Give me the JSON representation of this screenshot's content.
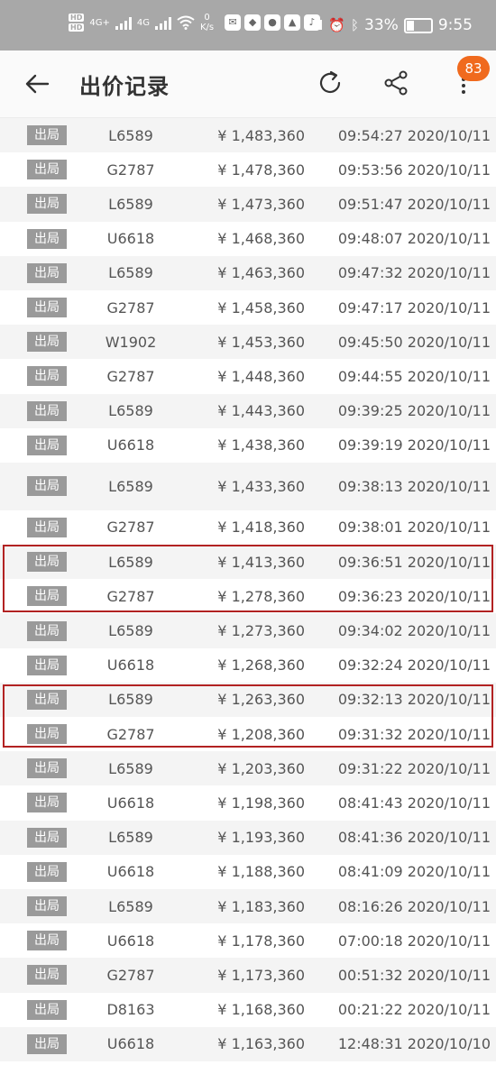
{
  "status_bar": {
    "hd1": "HD",
    "hd2": "HD",
    "net1": "4G+",
    "net2": "4G",
    "speed_value": "0",
    "speed_unit": "K/s",
    "battery": "33%",
    "time": "9:55",
    "battery_level": 0.33
  },
  "header": {
    "title": "出价记录",
    "badge": "83"
  },
  "tag_label": "出局",
  "bids": [
    {
      "tag": "出局",
      "bidder": "L6589",
      "price": "¥ 1,483,360",
      "time": "09:54:27 2020/10/11"
    },
    {
      "tag": "出局",
      "bidder": "G2787",
      "price": "¥ 1,478,360",
      "time": "09:53:56 2020/10/11"
    },
    {
      "tag": "出局",
      "bidder": "L6589",
      "price": "¥ 1,473,360",
      "time": "09:51:47 2020/10/11"
    },
    {
      "tag": "出局",
      "bidder": "U6618",
      "price": "¥ 1,468,360",
      "time": "09:48:07 2020/10/11"
    },
    {
      "tag": "出局",
      "bidder": "L6589",
      "price": "¥ 1,463,360",
      "time": "09:47:32 2020/10/11"
    },
    {
      "tag": "出局",
      "bidder": "G2787",
      "price": "¥ 1,458,360",
      "time": "09:47:17 2020/10/11"
    },
    {
      "tag": "出局",
      "bidder": "W1902",
      "price": "¥ 1,453,360",
      "time": "09:45:50 2020/10/11"
    },
    {
      "tag": "出局",
      "bidder": "G2787",
      "price": "¥ 1,448,360",
      "time": "09:44:55 2020/10/11"
    },
    {
      "tag": "出局",
      "bidder": "L6589",
      "price": "¥ 1,443,360",
      "time": "09:39:25 2020/10/11"
    },
    {
      "tag": "出局",
      "bidder": "U6618",
      "price": "¥ 1,438,360",
      "time": "09:39:19 2020/10/11"
    },
    {
      "tag": "出局",
      "bidder": "L6589",
      "price": "¥ 1,433,360",
      "time": "09:38:13 2020/10/11"
    },
    {
      "tag": "出局",
      "bidder": "G2787",
      "price": "¥ 1,418,360",
      "time": "09:38:01 2020/10/11"
    },
    {
      "tag": "出局",
      "bidder": "L6589",
      "price": "¥ 1,413,360",
      "time": "09:36:51 2020/10/11"
    },
    {
      "tag": "出局",
      "bidder": "G2787",
      "price": "¥ 1,278,360",
      "time": "09:36:23 2020/10/11"
    },
    {
      "tag": "出局",
      "bidder": "L6589",
      "price": "¥ 1,273,360",
      "time": "09:34:02 2020/10/11"
    },
    {
      "tag": "出局",
      "bidder": "U6618",
      "price": "¥ 1,268,360",
      "time": "09:32:24 2020/10/11"
    },
    {
      "tag": "出局",
      "bidder": "L6589",
      "price": "¥ 1,263,360",
      "time": "09:32:13 2020/10/11"
    },
    {
      "tag": "出局",
      "bidder": "G2787",
      "price": "¥ 1,208,360",
      "time": "09:31:32 2020/10/11"
    },
    {
      "tag": "出局",
      "bidder": "L6589",
      "price": "¥ 1,203,360",
      "time": "09:31:22 2020/10/11"
    },
    {
      "tag": "出局",
      "bidder": "U6618",
      "price": "¥ 1,198,360",
      "time": "08:41:43 2020/10/11"
    },
    {
      "tag": "出局",
      "bidder": "L6589",
      "price": "¥ 1,193,360",
      "time": "08:41:36 2020/10/11"
    },
    {
      "tag": "出局",
      "bidder": "U6618",
      "price": "¥ 1,188,360",
      "time": "08:41:09 2020/10/11"
    },
    {
      "tag": "出局",
      "bidder": "L6589",
      "price": "¥ 1,183,360",
      "time": "08:16:26 2020/10/11"
    },
    {
      "tag": "出局",
      "bidder": "U6618",
      "price": "¥ 1,178,360",
      "time": "07:00:18 2020/10/11"
    },
    {
      "tag": "出局",
      "bidder": "G2787",
      "price": "¥ 1,173,360",
      "time": "00:51:32 2020/10/11"
    },
    {
      "tag": "出局",
      "bidder": "D8163",
      "price": "¥ 1,168,360",
      "time": "00:21:22 2020/10/11"
    },
    {
      "tag": "出局",
      "bidder": "U6618",
      "price": "¥ 1,163,360",
      "time": "12:48:31 2020/10/10"
    }
  ],
  "highlight_color": "#b22222",
  "tag_color": "#9a9a9a",
  "badge_color": "#f06a1e"
}
